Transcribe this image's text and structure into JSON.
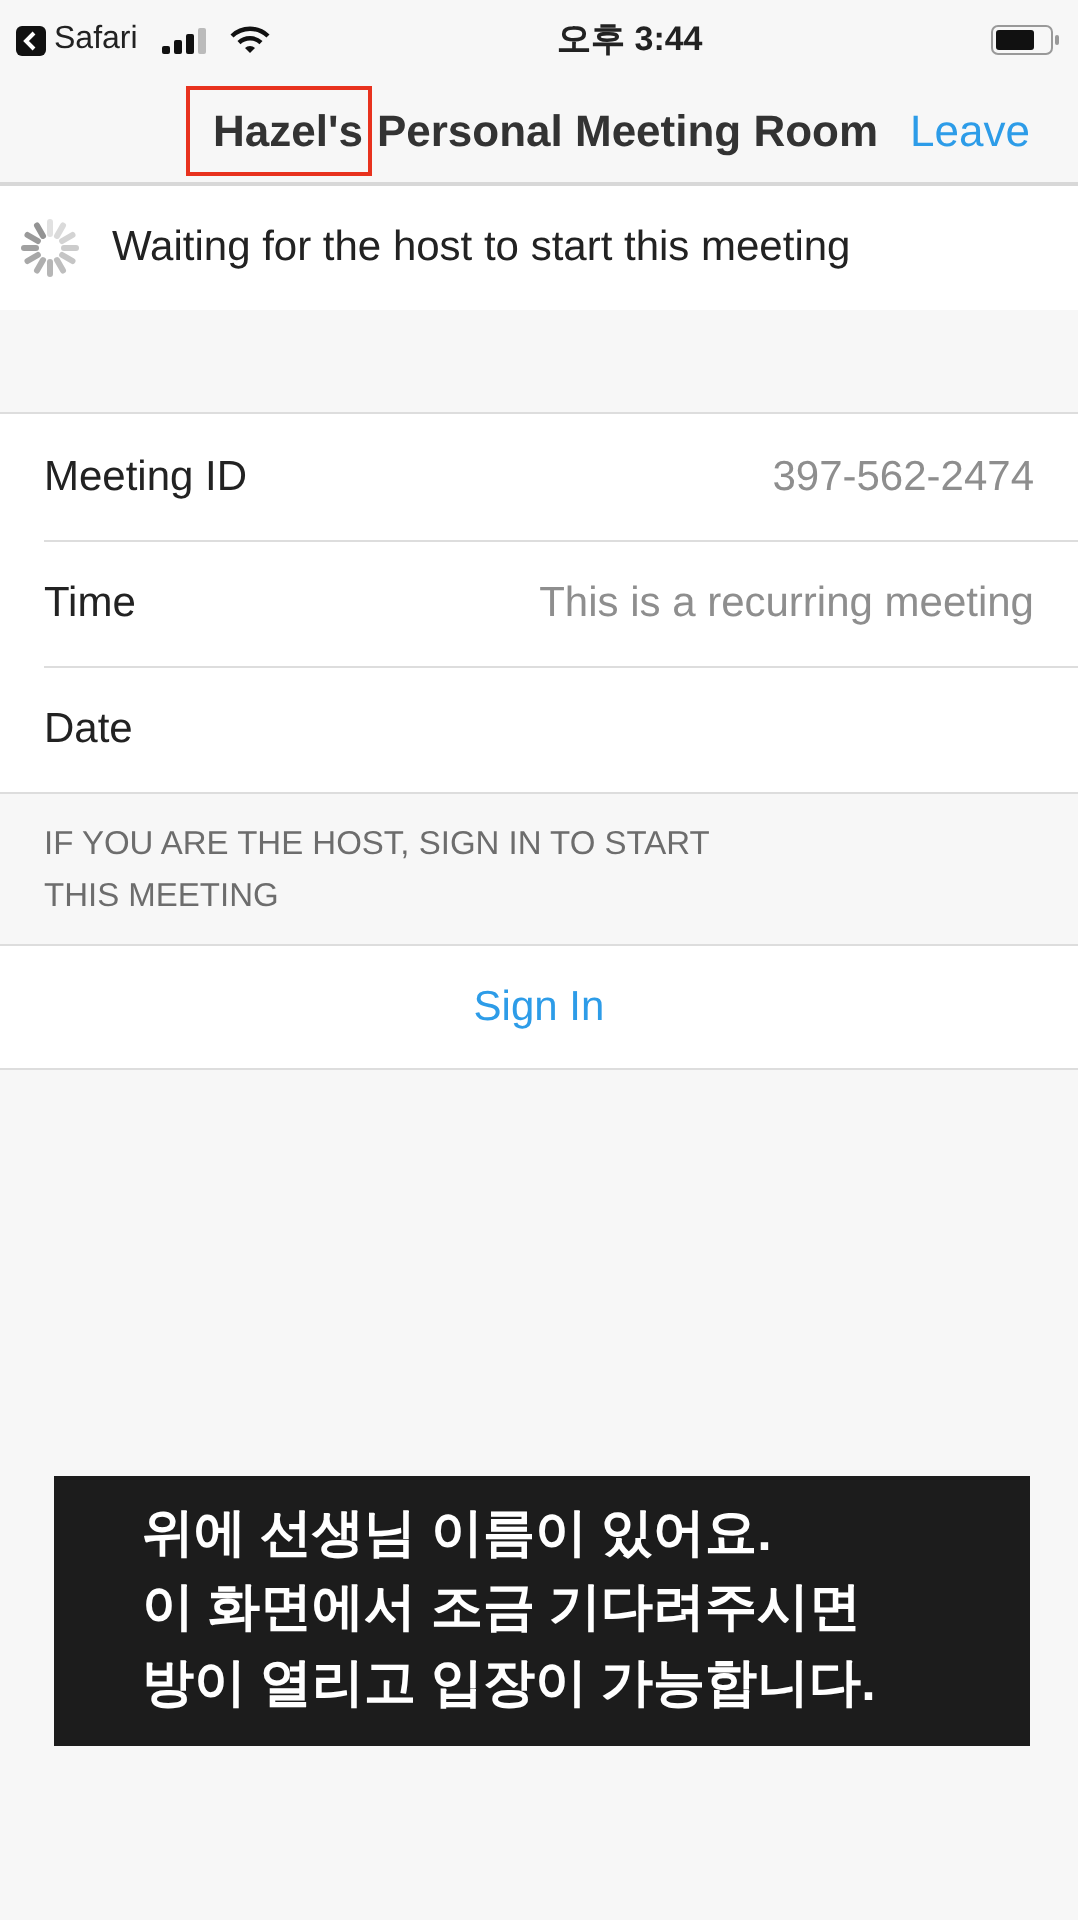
{
  "status_bar": {
    "back_app": "Safari",
    "time": "오후 3:44"
  },
  "nav": {
    "title_highlight": "Hazel's",
    "title_rest": "Personal Meeting Room",
    "highlight_marked": true,
    "action": "Leave"
  },
  "waiting": {
    "text": "Waiting for the host to start this meeting"
  },
  "details": [
    {
      "label": "Meeting ID",
      "value": "397-562-2474"
    },
    {
      "label": "Time",
      "value": "This is a recurring meeting"
    },
    {
      "label": "Date"
    }
  ],
  "host_note": {
    "text": "IF YOU ARE THE HOST, SIGN IN TO START\nTHIS MEETING"
  },
  "sign_in": {
    "label": "Sign In"
  },
  "caption": {
    "lines": [
      "위에 선생님 이름이 있어요.",
      "이 화면에서 조금 기다려주시면",
      "방이 열리고 입장이 가능합니다."
    ]
  }
}
